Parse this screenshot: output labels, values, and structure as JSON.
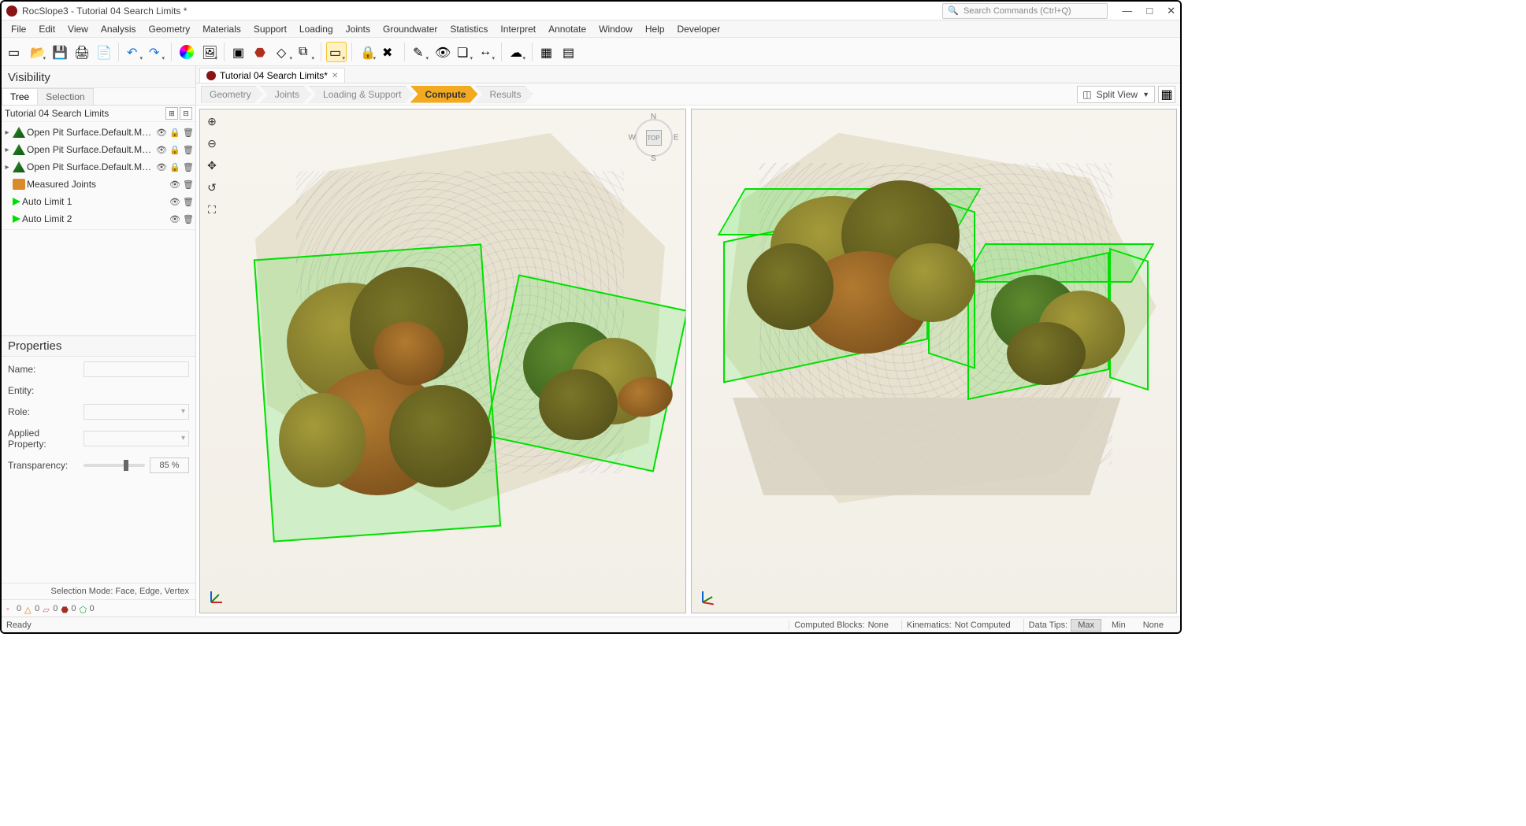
{
  "title_bar": {
    "app_title": "RocSlope3 - Tutorial 04 Search Limits *",
    "search_placeholder": "Search Commands (Ctrl+Q)"
  },
  "menu": [
    "File",
    "Edit",
    "View",
    "Analysis",
    "Geometry",
    "Materials",
    "Support",
    "Loading",
    "Joints",
    "Groundwater",
    "Statistics",
    "Interpret",
    "Annotate",
    "Window",
    "Help",
    "Developer"
  ],
  "toolbar_groups": [
    [
      "new-file",
      "open-file",
      "save",
      "print",
      "report"
    ],
    [
      "undo",
      "redo"
    ],
    [
      "color-wheel",
      "render-mode"
    ],
    [
      "select-box",
      "cube-solid",
      "cube-wire",
      "cube-multi"
    ],
    [
      "selection-tool"
    ],
    [
      "lock",
      "lock-x"
    ],
    [
      "wand",
      "eye",
      "stack",
      "move"
    ],
    [
      "cloud"
    ],
    [
      "grid1",
      "grid2"
    ]
  ],
  "visibility": {
    "title": "Visibility",
    "tabs": [
      "Tree",
      "Selection"
    ],
    "root": "Tutorial 04 Search Limits",
    "items": [
      {
        "type": "mesh",
        "label": "Open Pit Surface.Default.Mesh_ext",
        "exp": true,
        "lock": true
      },
      {
        "type": "mesh",
        "label": "Open Pit Surface.Default.Mesh_ext",
        "exp": true,
        "lock": true
      },
      {
        "type": "mesh",
        "label": "Open Pit Surface.Default.Mesh_ext",
        "exp": true,
        "lock": true
      },
      {
        "type": "joints",
        "label": "Measured Joints",
        "exp": false,
        "lock": false
      },
      {
        "type": "limit",
        "label": "Auto Limit 1",
        "exp": false,
        "lock": false
      },
      {
        "type": "limit",
        "label": "Auto Limit 2",
        "exp": false,
        "lock": false
      }
    ]
  },
  "properties": {
    "title": "Properties",
    "name_label": "Name:",
    "entity_label": "Entity:",
    "role_label": "Role:",
    "applied_label": "Applied Property:",
    "transparency_label": "Transparency:",
    "transparency_value": "85 %"
  },
  "selection_mode": "Selection Mode: Face, Edge, Vertex",
  "counts": [
    "0",
    "0",
    "0",
    "0",
    "0"
  ],
  "doc_tab": {
    "label": "Tutorial 04 Search Limits*"
  },
  "workflow": {
    "steps": [
      "Geometry",
      "Joints",
      "Loading & Support",
      "Compute",
      "Results"
    ],
    "active": 3,
    "view_mode": "Split View"
  },
  "compass": {
    "top": "TOP",
    "n": "N",
    "s": "S",
    "e": "E",
    "w": "W"
  },
  "status": {
    "ready": "Ready",
    "computed_blocks_label": "Computed Blocks:",
    "computed_blocks_value": "None",
    "kinematics_label": "Kinematics:",
    "kinematics_value": "Not Computed",
    "data_tips_label": "Data Tips:",
    "max": "Max",
    "min": "Min",
    "none": "None"
  }
}
